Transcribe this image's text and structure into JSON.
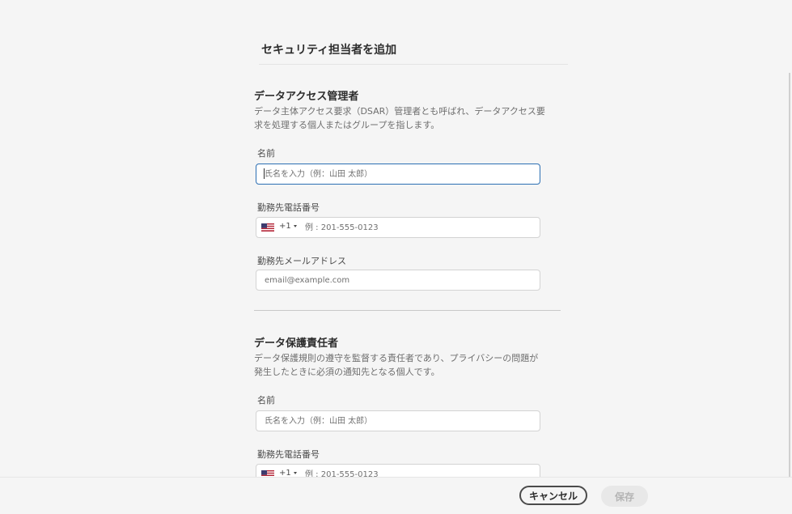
{
  "dialog": {
    "title": "セキュリティ担当者を追加"
  },
  "sections": [
    {
      "heading": "データアクセス管理者",
      "description": "データ主体アクセス要求（DSAR）管理者とも呼ばれ、データアクセス要求を処理する個人またはグループを指します。",
      "name_label": "名前",
      "name_placeholder": "氏名を入力（例：山田 太郎）",
      "phone_label": "勤務先電話番号",
      "phone_country_code": "+1",
      "phone_placeholder": "例 : 201-555-0123",
      "email_label": "勤務先メールアドレス",
      "email_placeholder": "email@example.com"
    },
    {
      "heading": "データ保護責任者",
      "description": "データ保護規則の遵守を監督する責任者であり、プライバシーの問題が発生したときに必須の通知先となる個人です。",
      "name_label": "名前",
      "name_placeholder": "氏名を入力（例：山田 太郎）",
      "phone_label": "勤務先電話番号",
      "phone_country_code": "+1",
      "phone_placeholder": "例 : 201-555-0123"
    }
  ],
  "footer": {
    "cancel_label": "キャンセル",
    "save_label": "保存"
  },
  "icons": {
    "flag": "us-flag-icon",
    "chevron": "chevron-down-icon"
  },
  "colors": {
    "focus_border": "#2c6fb3",
    "background": "#f5f5f5"
  }
}
